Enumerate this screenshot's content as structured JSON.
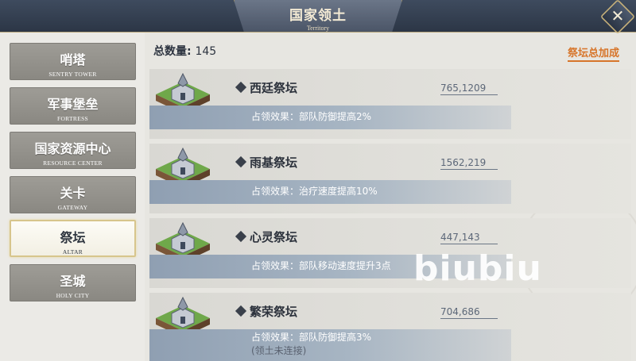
{
  "header": {
    "title": "国家领土",
    "subtitle": "Territory",
    "close_icon": "close-x-icon"
  },
  "sidebar": {
    "items": [
      {
        "cn": "哨塔",
        "en": "SENTRY TOWER",
        "active": false
      },
      {
        "cn": "军事堡垒",
        "en": "FORTRESS",
        "active": false
      },
      {
        "cn": "国家资源中心",
        "en": "RESOURCE CENTER",
        "active": false
      },
      {
        "cn": "关卡",
        "en": "GATEWAY",
        "active": false
      },
      {
        "cn": "祭坛",
        "en": "ALTAR",
        "active": true
      },
      {
        "cn": "圣城",
        "en": "HOLY CITY",
        "active": false
      }
    ]
  },
  "main": {
    "total_label": "总数量:",
    "total_value": "145",
    "altar_bonus_link": "祭坛总加成",
    "altars": [
      {
        "name": "西廷祭坛",
        "coords": "765,1209",
        "effect": "占领效果：部队防御提高2%",
        "note": ""
      },
      {
        "name": "雨基祭坛",
        "coords": "1562,219",
        "effect": "占领效果：治疗速度提高10%",
        "note": ""
      },
      {
        "name": "心灵祭坛",
        "coords": "447,143",
        "effect": "占领效果：部队移动速度提升3点",
        "note": ""
      },
      {
        "name": "繁荣祭坛",
        "coords": "704,686",
        "effect": "占领效果：部队防御提高3%",
        "note": "(领土未连接)"
      }
    ]
  },
  "watermark": "biubiu",
  "colors": {
    "header_bg": "#2c3646",
    "accent_orange": "#d7752a",
    "sidebar_item": "#8a8882",
    "active_border": "#d7c58c",
    "effect_band": "#8f9fb2",
    "tile_grass": "#6fa84a"
  }
}
